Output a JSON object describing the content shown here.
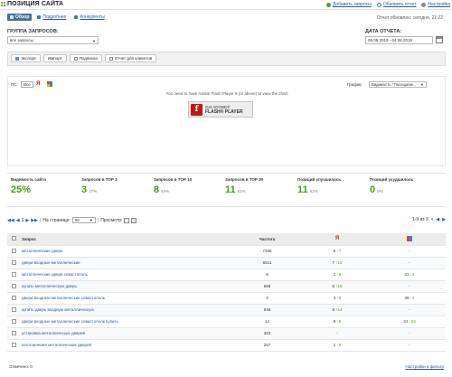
{
  "header": {
    "title": "ПОЗИЦИЯ САЙТА",
    "actions": [
      {
        "label": "Добавить запросы",
        "icon": "add-icon"
      },
      {
        "label": "Обновить отчет",
        "icon": "refresh-icon"
      },
      {
        "label": "Настройка",
        "icon": "gear-icon"
      }
    ]
  },
  "tabs": [
    {
      "label": "Обзор",
      "icon": "overview-icon",
      "active": true
    },
    {
      "label": "Подробнее",
      "icon": "details-icon",
      "active": false
    },
    {
      "label": "Конкуренты",
      "icon": "competitors-icon",
      "active": false
    }
  ],
  "report_updated": "Отчет обновлен: сегодня, 21:22",
  "group": {
    "label": "ГРУППА ЗАПРОСОВ:",
    "selected": "все запросы"
  },
  "date": {
    "label": "ДАТА ОТЧЕТА:",
    "value": "05.05.2019 - 04.06.2019"
  },
  "toolbar": {
    "buttons": [
      {
        "label": "Экспорт",
        "icon": "export-icon"
      },
      {
        "label": "Импорт",
        "icon": "import-icon"
      },
      {
        "label": "Подписка",
        "icon": "subscribe-icon"
      },
      {
        "label": "Отчет для клиентов",
        "icon": "report-icon"
      }
    ]
  },
  "chart_panel": {
    "ps_label": "ПС:",
    "se_all": "Все",
    "se_yandex": "Я",
    "graph_label": "График:",
    "graph_selected": "Видимость / Посещаем...",
    "flash_message": "You need to have Adobe Flash Player 9 (or above) to view the chart.",
    "flash_get": "Get ADOBE®",
    "flash_product": "FLASH® PLAYER"
  },
  "stats": [
    {
      "label": "Видимость сайта",
      "value": "25%",
      "pct": ""
    },
    {
      "label": "Запросов в TOP 3",
      "value": "3",
      "pct": "17%"
    },
    {
      "label": "Запросов в TOP 10",
      "value": "8",
      "pct": "44%"
    },
    {
      "label": "Запросов в TOP 30",
      "value": "11",
      "pct": "61%"
    },
    {
      "label": "Позиций улучшилось",
      "value": "11",
      "pct": "61%"
    },
    {
      "label": "Позиций ухудшилось",
      "value": "0",
      "pct": "0%"
    }
  ],
  "pager": {
    "page": "1",
    "per_page_label": "На странице:",
    "per_page": "50",
    "preview_label": "Просмотр:",
    "range": "1-9 из 9"
  },
  "table": {
    "headers": {
      "query": "Запрос",
      "frequency": "Частота"
    },
    "rows": [
      {
        "query": "металлические двери",
        "freq": "7266",
        "ya_pos": "6",
        "ya_delta": "↑7",
        "g_pos": "-",
        "g_delta": ""
      },
      {
        "query": "двери входные металлические",
        "freq": "6511",
        "ya_pos": "7",
        "ya_delta": "↑13",
        "g_pos": "-",
        "g_delta": ""
      },
      {
        "query": "металлические двери севастополь",
        "freq": "8",
        "ya_pos": "1",
        "ya_delta": "↑9",
        "g_pos": "21",
        "g_delta": "↑4"
      },
      {
        "query": "купить металлическую дверь",
        "freq": "668",
        "ya_pos": "8",
        "ya_delta": "↑15",
        "g_pos": "-",
        "g_delta": ""
      },
      {
        "query": "двери входные металлические севастополь",
        "freq": "3",
        "ya_pos": "3",
        "ya_delta": "↑9",
        "g_pos": "30",
        "g_delta": "↑2"
      },
      {
        "query": "купить дверь входную металлическую",
        "freq": "848",
        "ya_pos": "5",
        "ya_delta": "↑14",
        "g_pos": "-",
        "g_delta": ""
      },
      {
        "query": "двери входные металлические севастополь купить",
        "freq": "14",
        "ya_pos": "9",
        "ya_delta": "↑6",
        "g_pos": "24",
        "g_delta": "↑23"
      },
      {
        "query": "установка металлических дверей",
        "freq": "323",
        "ya_pos": "-",
        "ya_delta": "",
        "g_pos": "-",
        "g_delta": ""
      },
      {
        "query": "изготовление металлических дверей",
        "freq": "257",
        "ya_pos": "1",
        "ya_delta": "↑6",
        "g_pos": "-",
        "g_delta": ""
      }
    ]
  },
  "footer": {
    "checked": "Отмечено: 0",
    "settings": "Настройки и фильтр"
  },
  "colors": {
    "accent": "#4a6fa0",
    "link": "#2a5a9a",
    "positive": "#4a9a1a",
    "yandex": "#e00000"
  }
}
